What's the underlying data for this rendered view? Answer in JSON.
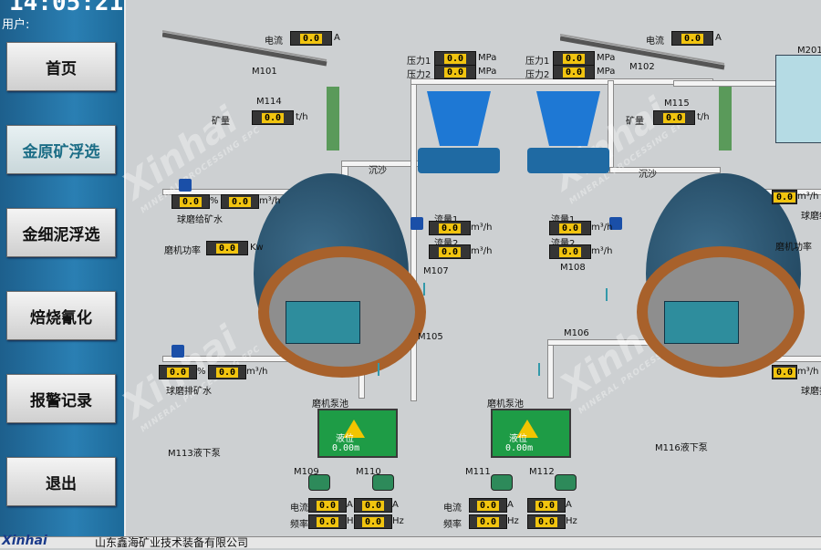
{
  "header": {
    "clock": "14:05:21",
    "user_label": "用户:"
  },
  "nav": [
    {
      "label": "首页"
    },
    {
      "label": "金原矿浮选"
    },
    {
      "label": "金细泥浮选"
    },
    {
      "label": "焙烧氰化"
    },
    {
      "label": "报警记录"
    },
    {
      "label": "退出"
    }
  ],
  "footer": {
    "logo": "Xinhai",
    "company": "山东鑫海矿业技术装备有限公司"
  },
  "watermark": {
    "text": "Xinhai",
    "sub": "MINERAL PROCESSING EPC"
  },
  "labels": {
    "current": "电流",
    "ore": "矿量",
    "m101": "M101",
    "m114": "M114",
    "m102": "M102",
    "m115": "M115",
    "pressure1": "压力1",
    "pressure2": "压力2",
    "pressure1_b": "压力1",
    "pressure2_b": "压力2",
    "sand": "沉沙",
    "sand_b": "沉沙",
    "feed_water": "球磨给矿水",
    "mill_power": "磨机功率",
    "mill_power_b": "磨机功率",
    "flow1": "流量1",
    "flow2": "流量2",
    "flow1_b": "流量1",
    "flow2_b": "流量2",
    "m107": "M107",
    "m108": "M108",
    "m105": "M105",
    "m106": "M106",
    "m201": "M201",
    "discharge_water": "球磨排矿水",
    "discharge_water_b": "球磨排",
    "mill_pool": "磨机泵池",
    "mill_pool_b": "磨机泵池",
    "level": "液位",
    "level_b": "液位",
    "m113": "M113液下泵",
    "m116": "M116液下泵",
    "m109": "M109",
    "m110": "M110",
    "m111": "M111",
    "m112": "M112",
    "current_l": "电流",
    "freq_l": "频率",
    "current_r": "电流",
    "freq_r": "频率",
    "feed_water_b": "球磨给"
  },
  "values": {
    "zero": "0.0",
    "level_val": "0.00m",
    "level_val_b": "0.00m"
  },
  "units": {
    "A": "A",
    "tph": "t/h",
    "MPa": "MPa",
    "pct": "%",
    "m3h": "m³/h",
    "Kw": "Kw",
    "Hz": "Hz"
  }
}
